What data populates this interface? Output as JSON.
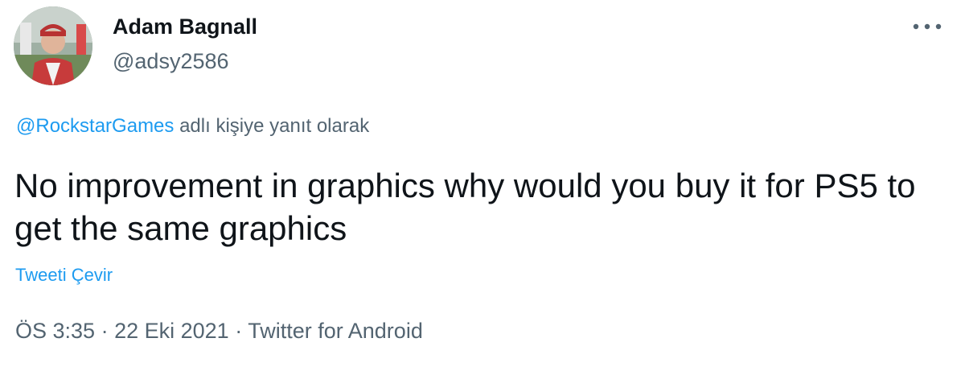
{
  "tweet": {
    "author": {
      "display_name": "Adam Bagnall",
      "handle": "@adsy2586"
    },
    "reply_to": {
      "mention": "@RockstarGames",
      "suffix": "adlı kişiye yanıt olarak"
    },
    "text": "No improvement in graphics why would you buy it for PS5 to get the same graphics",
    "translate_label": "Tweeti Çevir",
    "meta": {
      "time": "ÖS 3:35",
      "separator": "·",
      "date": "22 Eki 2021",
      "source": "Twitter for Android"
    }
  },
  "icons": {
    "more": "more-horizontal-icon"
  },
  "colors": {
    "text_primary": "#0f1419",
    "text_secondary": "#536471",
    "accent": "#1d9bf0"
  }
}
